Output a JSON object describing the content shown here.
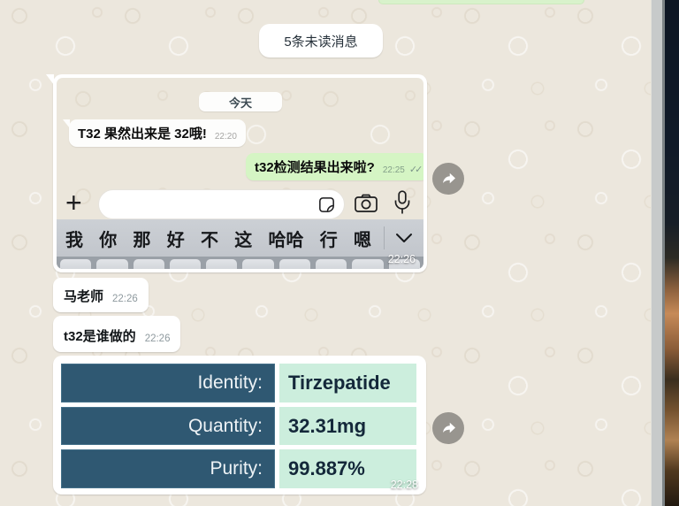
{
  "chat": {
    "unread_badge": "5条未读消息"
  },
  "screenshot_message": {
    "date_label": "今天",
    "incoming_text": "T32 果然出来是 32哦!",
    "incoming_time": "22:20",
    "outgoing_text": "t32检测结果出来啦?",
    "outgoing_time": "22:25",
    "predictive_chars": [
      "我",
      "你",
      "那",
      "好",
      "不",
      "这",
      "哈哈",
      "行",
      "嗯"
    ],
    "sent_time": "22:26"
  },
  "text_messages": [
    {
      "text": "马老师",
      "time": "22:26"
    },
    {
      "text": "t32是谁做的",
      "time": "22:26"
    }
  ],
  "report_message": {
    "rows": [
      {
        "label": "Identity:",
        "value": "Tirzepatide"
      },
      {
        "label": "Quantity:",
        "value": "32.31mg"
      },
      {
        "label": "Purity:",
        "value": "99.887%"
      }
    ],
    "sent_time": "22:28"
  },
  "icons": {
    "plus": "+",
    "double_check": "✓✓"
  },
  "colors": {
    "chat_bg": "#ece7dd",
    "incoming_bubble": "#ffffff",
    "outgoing_bubble": "#d5f5c4",
    "report_label_bg": "#2f5872",
    "report_value_bg": "#cceedd"
  }
}
